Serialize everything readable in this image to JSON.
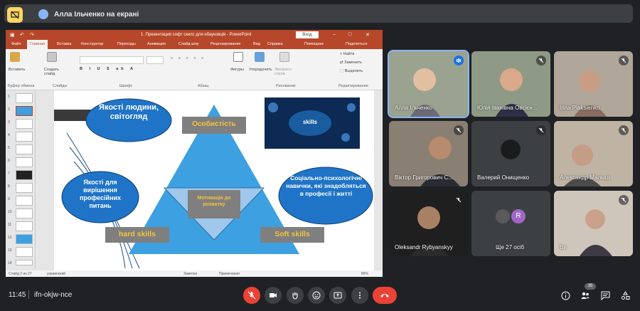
{
  "topbar": {
    "title": "Алла Ільченко на екрані"
  },
  "ppt": {
    "window_title": "1. Презентация софт скилс для нбауковців  -  PowerPoint",
    "login": "Вход",
    "tabs": [
      "Файл",
      "Главная",
      "Вставка",
      "Конструктор",
      "Переходы",
      "Анимация",
      "Слайд-шоу",
      "Рецензирование",
      "Вид",
      "Справка",
      "Помощник",
      "Поделиться"
    ],
    "ribbon": {
      "paste": "Вставить",
      "create_slide": "Создать слайд",
      "groups": [
        "Буфер обмена",
        "Слайды",
        "Шрифт",
        "Абзац",
        "Рисование",
        "Редактирование"
      ],
      "shapes": "Фигуры",
      "arrange": "Упорядочить",
      "express_styles": "Экспресс-стили",
      "find": "Найти",
      "replace": "Заменить",
      "select": "Выделить"
    },
    "thumb_numbers": [
      "1",
      "2",
      "3",
      "4",
      "5",
      "6",
      "7",
      "8",
      "9",
      "10",
      "11",
      "12",
      "13",
      "14"
    ],
    "status": {
      "slide": "Слайд 2 из 27",
      "lang": "украинский",
      "notes": "Заметки",
      "comments": "Примечания",
      "zoom": "86%"
    },
    "slide": {
      "oval_top": "Якості людини, світогляд",
      "oval_left": "Якості для вирішення професійних питань",
      "oval_right": "Соціально-психологічні навички, які знадобляться в професії і житті",
      "top_label": "Особистість",
      "center_label": "Мотивація до розвитку",
      "hard": "hard skills",
      "soft": "Soft skills",
      "image_word": "skills"
    }
  },
  "participants": [
    {
      "name": "Алла Ільченко",
      "speaking": true
    },
    {
      "name": "Юлія Іванівна Овсієн...",
      "speaking": false
    },
    {
      "name": "Irina Plaksienko",
      "speaking": false
    },
    {
      "name": "Віктор Григорович С...",
      "speaking": false
    },
    {
      "name": "Валерий Онищенко",
      "speaking": false
    },
    {
      "name": "Александр Малыш",
      "speaking": false
    },
    {
      "name": "Oleksandr Rybyanskyy",
      "speaking": false
    },
    {
      "name": "Ще 27 осіб",
      "speaking": false,
      "avatar_letter": "R"
    },
    {
      "name": "Ви",
      "speaking": false
    }
  ],
  "bottom": {
    "time": "11:45",
    "meeting_code": "ifn-okjw-nce",
    "people_count": "35"
  },
  "colors": {
    "ppt_red": "#b7472a",
    "slide_blue": "#1f74c7",
    "triangle": "#3da0e0",
    "label_gold": "#f5c33b",
    "accent": "#8ab4f8",
    "hangup": "#ea4335"
  }
}
